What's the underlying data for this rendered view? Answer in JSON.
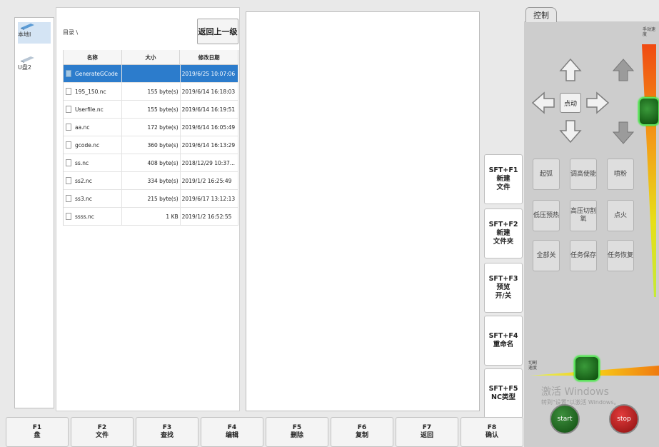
{
  "drives": [
    {
      "label": "本地I",
      "selected": true
    },
    {
      "label": "U盘2",
      "selected": false
    }
  ],
  "breadcrumb": "目录 \\",
  "up_button": "返回上一级",
  "table": {
    "headers": [
      "名称",
      "大小",
      "修改日期"
    ],
    "rows": [
      {
        "name": "GenerateGCode",
        "size": "",
        "date": "2019/6/25 10:07:06",
        "selected": true,
        "folder": true
      },
      {
        "name": "195_150.nc",
        "size": "155 byte(s)",
        "date": "2019/6/14 16:18:03"
      },
      {
        "name": "Userfile.nc",
        "size": "155 byte(s)",
        "date": "2019/6/14 16:19:51"
      },
      {
        "name": "aa.nc",
        "size": "172 byte(s)",
        "date": "2019/6/14 16:05:49"
      },
      {
        "name": "gcode.nc",
        "size": "360 byte(s)",
        "date": "2019/6/14 16:13:29"
      },
      {
        "name": "ss.nc",
        "size": "408 byte(s)",
        "date": "2018/12/29 10:37..."
      },
      {
        "name": "ss2.nc",
        "size": "334 byte(s)",
        "date": "2019/1/2 16:25:49"
      },
      {
        "name": "ss3.nc",
        "size": "215 byte(s)",
        "date": "2019/6/17 13:12:13"
      },
      {
        "name": "ssss.nc",
        "size": "1 KB",
        "date": "2019/1/2 16:52:55"
      }
    ]
  },
  "sft_buttons": [
    {
      "key": "SFT+F1",
      "label1": "新建",
      "label2": "文件"
    },
    {
      "key": "SFT+F2",
      "label1": "新建",
      "label2": "文件夹"
    },
    {
      "key": "SFT+F3",
      "label1": "预览",
      "label2": "开/关"
    },
    {
      "key": "SFT+F4",
      "label1": "重命名",
      "label2": ""
    },
    {
      "key": "SFT+F5",
      "label1": "NC类型",
      "label2": ""
    }
  ],
  "fkeys": [
    {
      "key": "F1",
      "label": "盘"
    },
    {
      "key": "F2",
      "label": "文件"
    },
    {
      "key": "F3",
      "label": "查找"
    },
    {
      "key": "F4",
      "label": "编辑"
    },
    {
      "key": "F5",
      "label": "删除"
    },
    {
      "key": "F6",
      "label": "复制"
    },
    {
      "key": "F7",
      "label": "返回"
    },
    {
      "key": "F8",
      "label": "确认"
    }
  ],
  "control": {
    "tab": "控制",
    "jog_label": "点动",
    "speed_label_top": "手动速度",
    "speed_label_bottom": "切割速度",
    "buttons": [
      "起弧",
      "调高使能",
      "喷粉",
      "低压预热",
      "高压切割氧",
      "点火",
      "全部关",
      "任务保存",
      "任务恢复"
    ],
    "start": "start",
    "stop": "stop",
    "watermark": "激活 Windows",
    "watermark_sub": "转到\"设置\"以激活 Windows。"
  },
  "colors": {
    "selection": "#2c7ccc",
    "start": "#1a6a1a",
    "stop": "#c61a1a"
  }
}
